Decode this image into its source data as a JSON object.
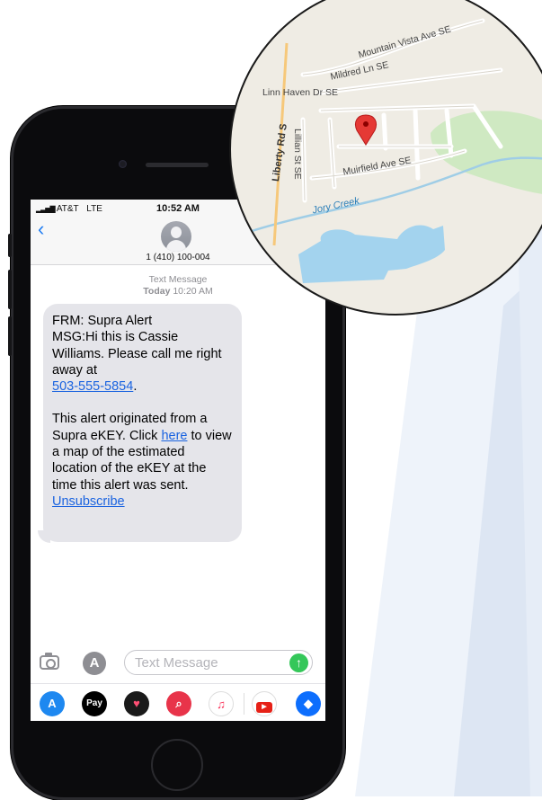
{
  "phone": {
    "status_bar": {
      "carrier": "AT&T",
      "network": "LTE",
      "time": "10:52 AM"
    },
    "header": {
      "back_icon": "chevron-left-icon",
      "contact_number": "1 (410) 100-004"
    },
    "conversation": {
      "meta_type": "Text Message",
      "meta_day": "Today",
      "meta_time": "10:20 AM",
      "message": {
        "line1": "FRM: Supra Alert",
        "line2": "MSG:Hi this is Cassie Williams. Please call me right away at",
        "phone_link": "503-555-5854",
        "after_phone": ".",
        "para2_before_link": "This alert originated from a Supra eKEY. Click",
        "here_link": "here",
        "para2_after_link": "to view a map of the estimated location of the eKEY at the time this alert was sent.",
        "unsubscribe_link": "Unsubscribe"
      }
    },
    "input": {
      "placeholder": "Text Message",
      "camera_icon": "camera-icon",
      "apps_icon": "app-store-icon",
      "send_icon": "send-arrow-icon"
    },
    "app_tray": [
      "app-store-icon",
      "apple-pay-icon",
      "digital-touch-icon",
      "search-images-icon",
      "music-icon",
      "youtube-icon",
      "dropbox-icon"
    ],
    "apple_pay_label": "Pay"
  },
  "map": {
    "streets": [
      "Mountain Vista Ave SE",
      "Mildred Ln SE",
      "Linn Haven Dr SE",
      "Lillian St SE",
      "Muirfield Ave SE",
      "Liberty Rd S"
    ],
    "creek": "Jory Creek",
    "pin_icon": "map-pin-icon",
    "colors": {
      "water": "#a3d3ee",
      "park": "#cfe9c2",
      "land": "#efece4",
      "pin": "#e53935",
      "major_road": "#f6c87a"
    }
  },
  "colors": {
    "link": "#1a63e0",
    "bubble": "#e5e5ea",
    "accent": "#1e7cf2",
    "send": "#34c759"
  }
}
